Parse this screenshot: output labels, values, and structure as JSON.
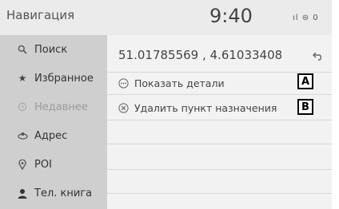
{
  "header": {
    "title": "Навигация",
    "time": "9:40",
    "status_text": "ıl ⊜ 0"
  },
  "sidebar": {
    "items": [
      {
        "label": "Поиск",
        "icon": "search-icon",
        "enabled": true
      },
      {
        "label": "Избранное",
        "icon": "star-icon",
        "enabled": true
      },
      {
        "label": "Недавнее",
        "icon": "clock-icon",
        "enabled": false
      },
      {
        "label": "Адрес",
        "icon": "address-icon",
        "enabled": true
      },
      {
        "label": "POI",
        "icon": "pin-icon",
        "enabled": true
      },
      {
        "label": "Тел. книга",
        "icon": "person-icon",
        "enabled": true
      }
    ]
  },
  "main": {
    "coordinates": "51.01785569 , 4.61033408",
    "actions": [
      {
        "label": "Показать детали",
        "icon": "details-icon"
      },
      {
        "label": "Удалить пункт назначения",
        "icon": "delete-icon"
      }
    ]
  },
  "callouts": {
    "a": "A",
    "b": "B"
  },
  "colors": {
    "sidebar_bg": "#cfcfcf",
    "main_bg": "#f2f2f2",
    "disabled_text": "#9a9a9a"
  }
}
